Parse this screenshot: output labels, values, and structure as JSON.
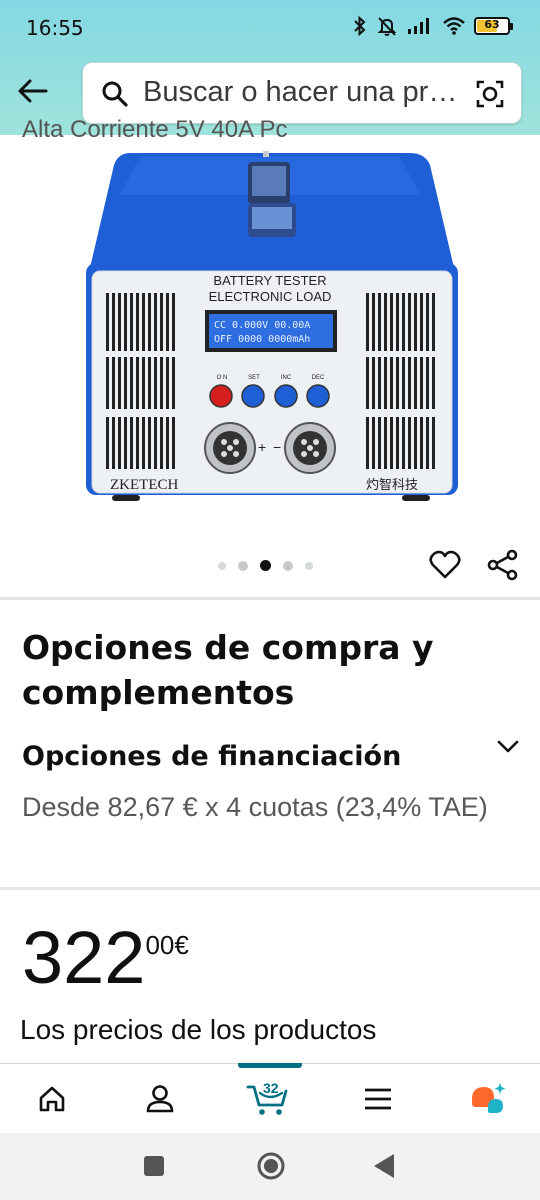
{
  "status_bar": {
    "time": "16:55",
    "battery_level": "63"
  },
  "header": {
    "search_placeholder": "Buscar o hacer una pregunta"
  },
  "product": {
    "clipped_title": "Alta Corriente 5V 40A Pc",
    "device": {
      "line1": "BATTERY TESTER",
      "line2": "ELECTRONIC  LOAD",
      "lcd1": "CC 0.000V 00.00A",
      "lcd2": "OFF 0000 0000mAh",
      "btn_on": "O N",
      "btn_set": "SET",
      "btn_inc": "INC",
      "btn_dec": "DEC",
      "brand_en": "ZKETECH",
      "brand_cn": "灼智科技",
      "plus": "+",
      "minus": "−"
    },
    "carousel": {
      "count": 5,
      "active_index": 2
    }
  },
  "purchase": {
    "heading": "Opciones de compra y complementos",
    "financing_title": "Opciones de financiación",
    "financing_text": "Desde 82,67 € x 4 cuotas (23,4% TAE)"
  },
  "price": {
    "whole": "322",
    "fraction": "00",
    "currency": "€"
  },
  "prices_note": "Los precios de los productos",
  "bottom_nav": {
    "cart_count": "32",
    "items": [
      "home-icon",
      "account-icon",
      "cart-icon",
      "menu-icon",
      "rufus-icon"
    ]
  },
  "colors": {
    "header_bg": "#84d8e3",
    "accent_teal": "#007185",
    "device_blue": "#1f5fd6",
    "rufus_orange": "#ff6a2c"
  }
}
